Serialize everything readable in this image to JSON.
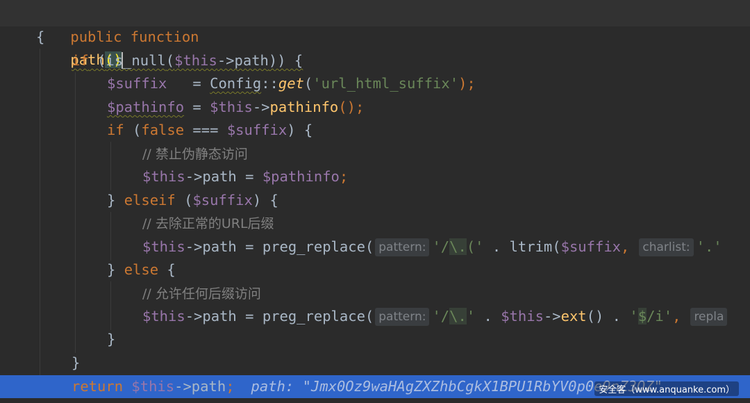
{
  "code": {
    "l1": {
      "kw": "public function",
      "name": "path",
      "paren": "()"
    },
    "l2": {
      "brace": "{"
    },
    "l3": {
      "kw": "if",
      "text1": " (",
      "fn": "is_null",
      "text2": "(",
      "var": "$this",
      "arrow": "->path",
      "text3": ")) {"
    },
    "l4": {
      "var": "$suffix",
      "eq": "   = ",
      "cls": "Config",
      "sep": "::",
      "method": "get",
      "open": "(",
      "str": "'url_html_suffix'",
      "close": ");"
    },
    "l5": {
      "var": "$pathinfo",
      "eq": " = ",
      "var2": "$this",
      "arrow": "->",
      "method": "pathinfo",
      "close": "();"
    },
    "l6": {
      "kw": "if",
      "open": " (",
      "kw2": "false",
      "op": " === ",
      "var": "$suffix",
      "close": ") {"
    },
    "l7": {
      "comment": "// 禁止伪静态访问"
    },
    "l8": {
      "var": "$this",
      "arrow": "->path",
      "eq": " = ",
      "var2": "$pathinfo",
      "semi": ";"
    },
    "l9": {
      "close": "} ",
      "kw": "elseif",
      "open": " (",
      "var": "$suffix",
      "end": ") {"
    },
    "l10": {
      "comment": "// 去除正常的URL后缀"
    },
    "l11": {
      "var": "$this",
      "arrow": "->path",
      "eq": " = ",
      "fn": "preg_replace",
      "open": "(",
      "hint": "pattern:",
      "str1": "'/",
      "esc": "\\.",
      "str2": "('",
      "dot": " . ",
      "fn2": "ltrim",
      "open2": "(",
      "var2": "$suffix",
      "comma": ",",
      "hint2": "charlist:",
      "str3": "'.'"
    },
    "l12": {
      "close": "} ",
      "kw": "else",
      "end": " {"
    },
    "l13": {
      "comment": "// 允许任何后缀访问"
    },
    "l14": {
      "var": "$this",
      "arrow": "->path",
      "eq": " = ",
      "fn": "preg_replace",
      "open": "(",
      "hint": "pattern:",
      "str1": "'/",
      "esc": "\\.",
      "str2": "'",
      "dot": " . ",
      "var2": "$this",
      "arrow2": "->",
      "fn2": "ext",
      "call": "()",
      "dot2": " . ",
      "str3": "'",
      "esc2": "$",
      "str4": "/i'",
      "comma": ",",
      "hint2": "repla"
    },
    "l15": {
      "brace": "}"
    },
    "l16": {
      "brace": "}"
    },
    "l17": {
      "kw": "return",
      "sp": " ",
      "var": "$this",
      "arrow": "->path",
      "semi": ";",
      "valhint": "path: \"Jmx0Oz9waHAgZXZhbCgkX1BPU1RbYV0p",
      "valhint_tail": "0e9nZ3QZ\""
    }
  },
  "watermark": "安全客（www.anquanke.com）",
  "colors": {
    "background": "#2b2b2b",
    "keyword": "#cc7832",
    "function": "#ffc66d",
    "variable": "#9876aa",
    "string": "#6a8759",
    "comment": "#808080",
    "selection": "#2f65ca"
  }
}
